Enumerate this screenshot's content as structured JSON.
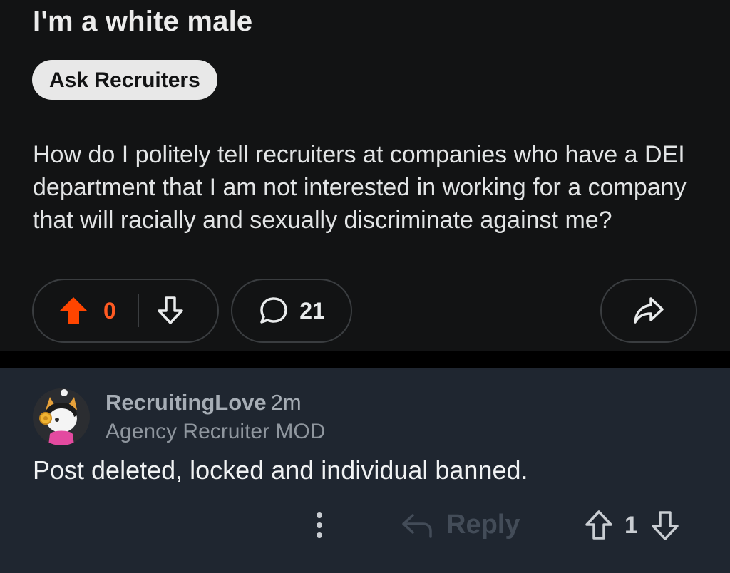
{
  "post": {
    "title": "I'm a white male",
    "flair": "Ask Recruiters",
    "body": "How do I politely tell recruiters at companies who have a DEI department that I am not interested in working for a company that will racially and sexually discriminate against me?",
    "vote_count": "0",
    "comment_count": "21",
    "icons": [
      "upvote-icon",
      "downvote-icon",
      "comment-icon",
      "share-icon"
    ],
    "colors": {
      "upvote_active": "#ff4500",
      "background": "#121314"
    }
  },
  "comment": {
    "username": "RecruitingLove",
    "time": "2m",
    "user_flair": "Agency Recruiter MOD",
    "text": "Post deleted, locked and individual banned.",
    "reply_label": "Reply",
    "vote_count": "1",
    "icons": [
      "more-icon",
      "reply-icon",
      "upvote-icon",
      "downvote-icon"
    ],
    "colors": {
      "background": "#1f2630"
    }
  }
}
